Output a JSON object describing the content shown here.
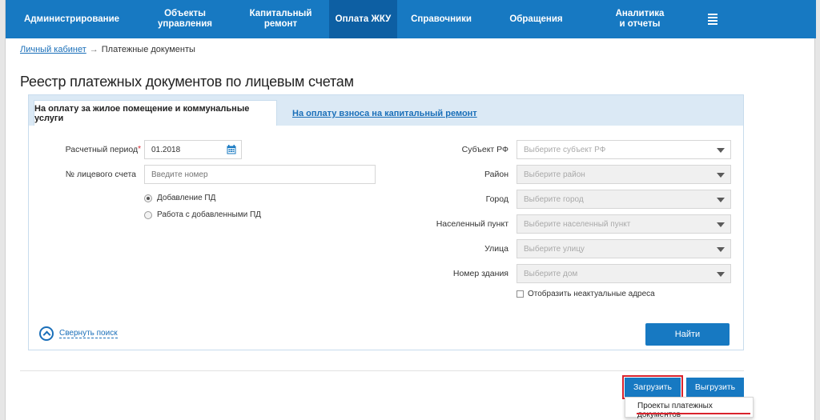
{
  "nav": {
    "items": [
      {
        "label": "Администрирование"
      },
      {
        "label": "Объекты управления"
      },
      {
        "label": "Капитальный ремонт"
      },
      {
        "label": "Оплата ЖКУ",
        "active": true
      },
      {
        "label": "Справочники"
      },
      {
        "label": "Обращения"
      },
      {
        "label": "Аналитика и отчеты"
      }
    ],
    "menu_icon": "menu-icon",
    "color": "#1779c2",
    "active_color": "#0d5fa3"
  },
  "breadcrumb": {
    "link": "Личный кабинет",
    "arrow": "→",
    "current": "Платежные документы"
  },
  "page_title": "Реестр платежных документов по лицевым счетам",
  "tabs": {
    "active": "На оплату за жилое помещение и коммунальные услуги",
    "inactive": "На оплату взноса на капитальный ремонт"
  },
  "form": {
    "period_label": "Расчетный период",
    "period_required": "*",
    "period_value": "01.2018",
    "account_label": "№ лицевого счета",
    "account_placeholder": "Введите номер",
    "radio_add": "Добавление ПД",
    "radio_work": "Работа с добавленными ПД",
    "subject_label": "Субъект РФ",
    "subject_placeholder": "Выберите субъект РФ",
    "district_label": "Район",
    "district_placeholder": "Выберите район",
    "city_label": "Город",
    "city_placeholder": "Выберите город",
    "locality_label": "Населенный пункт",
    "locality_placeholder": "Выберите населенный пункт",
    "street_label": "Улица",
    "street_placeholder": "Выберите улицу",
    "house_label": "Номер здания",
    "house_placeholder": "Выберите дом",
    "show_inactive": "Отобразить неактуальные адреса",
    "collapse": "Свернуть поиск",
    "find": "Найти"
  },
  "actions": {
    "upload": "Загрузить",
    "download": "Выгрузить",
    "dropdown_item": "Проекты платежных документов"
  },
  "accent_red": "#d9232d"
}
